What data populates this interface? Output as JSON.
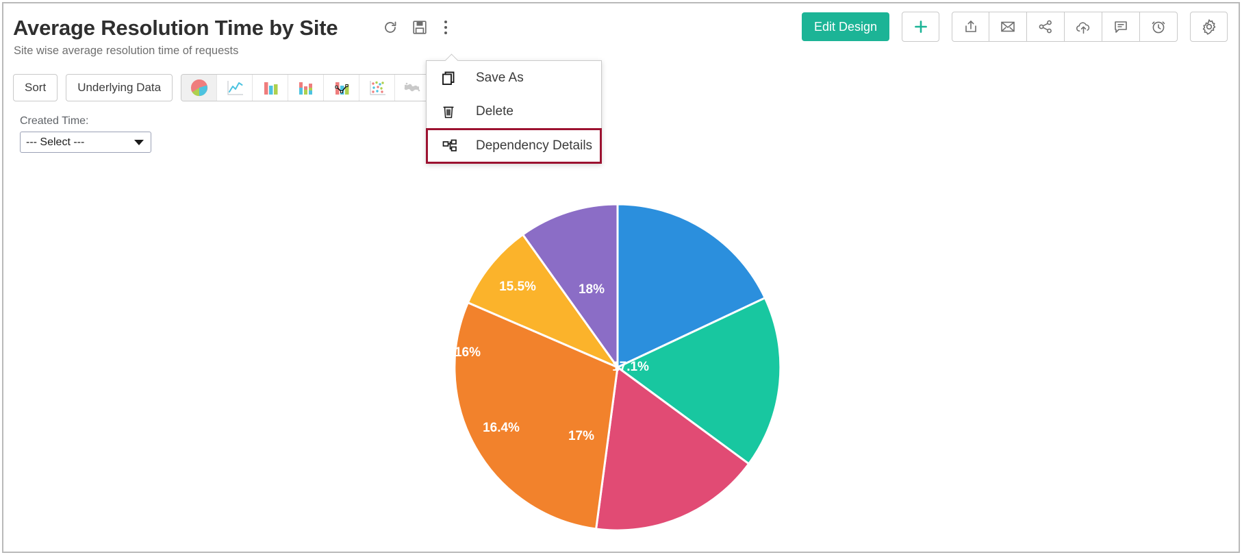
{
  "header": {
    "title": "Average Resolution Time by Site",
    "subtitle": "Site wise average resolution time of requests",
    "title_actions": [
      {
        "name": "refresh-icon",
        "label": "Refresh"
      },
      {
        "name": "save-icon",
        "label": "Save"
      },
      {
        "name": "more-options-icon",
        "label": "More Options"
      }
    ]
  },
  "right_toolbar": {
    "edit_design_label": "Edit Design",
    "buttons": [
      {
        "name": "add-button",
        "label": "Add"
      },
      {
        "name": "export-button",
        "label": "Export"
      },
      {
        "name": "email-button",
        "label": "Email"
      },
      {
        "name": "share-button",
        "label": "Share"
      },
      {
        "name": "publish-button",
        "label": "Publish"
      },
      {
        "name": "comments-button",
        "label": "Comments"
      },
      {
        "name": "schedule-button",
        "label": "Schedule"
      },
      {
        "name": "settings-button",
        "label": "Settings"
      }
    ]
  },
  "toolbar": {
    "sort_label": "Sort",
    "underlying_data_label": "Underlying Data",
    "chart_types": [
      {
        "name": "chart-type-pie",
        "label": "Pie",
        "active": true
      },
      {
        "name": "chart-type-line",
        "label": "Line",
        "active": false
      },
      {
        "name": "chart-type-bar",
        "label": "Bar",
        "active": false
      },
      {
        "name": "chart-type-stacked-bar",
        "label": "Stacked Bar",
        "active": false
      },
      {
        "name": "chart-type-combo",
        "label": "Combination",
        "active": false
      },
      {
        "name": "chart-type-scatter",
        "label": "Scatter",
        "active": false
      },
      {
        "name": "chart-type-map",
        "label": "Map",
        "active": false
      }
    ]
  },
  "filter": {
    "label": "Created Time:",
    "selected": "--- Select ---"
  },
  "menu": {
    "items": [
      {
        "name": "menu-item-save-as",
        "label": "Save As",
        "icon": "copy-icon",
        "highlighted": false
      },
      {
        "name": "menu-item-delete",
        "label": "Delete",
        "icon": "trash-icon",
        "highlighted": false
      },
      {
        "name": "menu-item-dependency-details",
        "label": "Dependency Details",
        "icon": "dependency-icon",
        "highlighted": true
      }
    ],
    "highlight_color": "#9c1230"
  },
  "chart_data": {
    "type": "pie",
    "title": "Average Resolution Time by Site",
    "subtitle": "Site wise average resolution time of requests",
    "labels": [
      "18%",
      "17.1%",
      "17%",
      "16.4%",
      "16%",
      "15.5%"
    ],
    "values": [
      18,
      17.1,
      17,
      16.4,
      16,
      15.5
    ],
    "colors": [
      "#2b8fdd",
      "#18c7a0",
      "#e14b74",
      "#f2822c",
      "#fbb river",
      "#8b6dc6"
    ],
    "slice_colors": [
      "#2b8fdd",
      "#18c7a0",
      "#e14b74",
      "#f2822c",
      "#fbb32b",
      "#8b6dc6"
    ],
    "legend": "none",
    "start_angle_deg": 0,
    "units": "percent"
  }
}
